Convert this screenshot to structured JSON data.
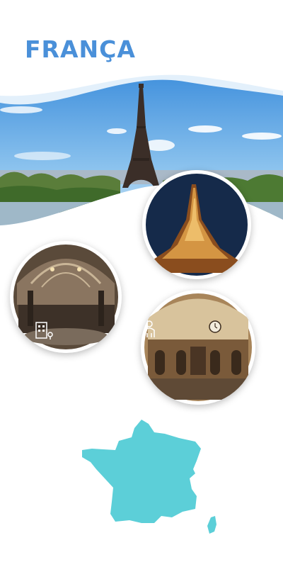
{
  "title": "FRANÇA",
  "colors": {
    "title": "#4a90d9",
    "map_fill": "#5ccfd8",
    "wave": "#d9ecfb",
    "sky": "#5aa6e6"
  },
  "images": {
    "hero": "eiffel-tower-daytime-photo",
    "circle_1": "eiffel-tower-night-photo",
    "circle_2": "station-hall-interior-photo",
    "circle_3": "station-hall-clock-photo"
  },
  "icons": {
    "circle_2": "building-location-icon",
    "circle_3": "person-icon"
  }
}
